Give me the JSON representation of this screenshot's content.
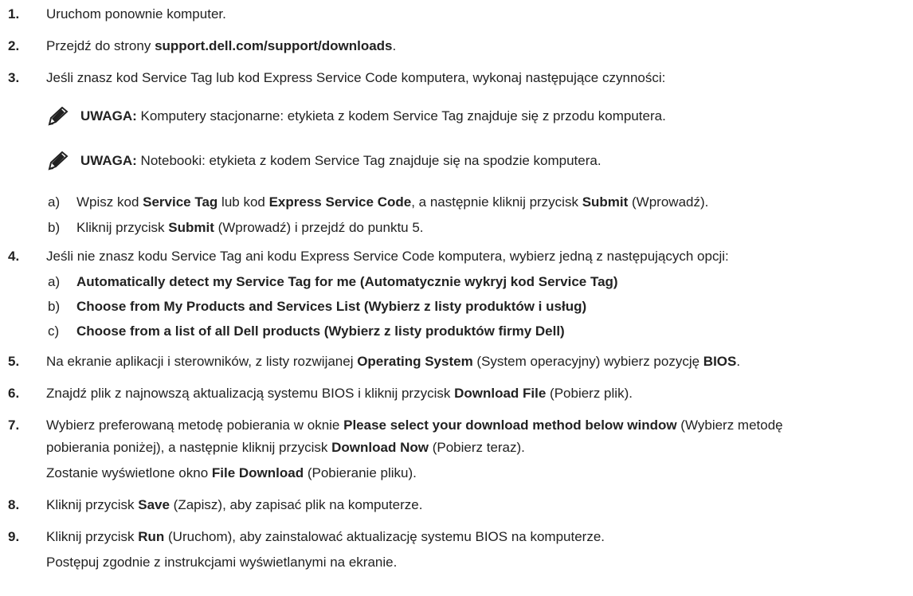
{
  "steps": [
    {
      "num": "1.",
      "segments": [
        {
          "t": "Uruchom ponownie komputer."
        }
      ]
    },
    {
      "num": "2.",
      "segments": [
        {
          "t": "Przejdź do strony "
        },
        {
          "t": "support.dell.com/support/downloads",
          "b": true
        },
        {
          "t": "."
        }
      ]
    },
    {
      "num": "3.",
      "segments": [
        {
          "t": "Jeśli znasz kod Service Tag lub kod Express Service Code komputera, wykonaj następujące czynności:"
        }
      ]
    },
    {
      "num": "4.",
      "segments": [
        {
          "t": "Jeśli nie znasz kodu Service Tag ani kodu Express Service Code komputera, wybierz jedną z następujących opcji:"
        }
      ]
    },
    {
      "num": "5.",
      "segments": [
        {
          "t": "Na ekranie aplikacji i sterowników, z listy rozwijanej "
        },
        {
          "t": "Operating System",
          "b": true
        },
        {
          "t": " (System operacyjny) wybierz pozycję "
        },
        {
          "t": "BIOS",
          "b": true
        },
        {
          "t": "."
        }
      ]
    },
    {
      "num": "6.",
      "segments": [
        {
          "t": "Znajdź plik z najnowszą aktualizacją systemu BIOS i kliknij przycisk "
        },
        {
          "t": "Download File",
          "b": true
        },
        {
          "t": " (Pobierz plik)."
        }
      ]
    },
    {
      "num": "7.",
      "segments": [
        {
          "t": "Wybierz preferowaną metodę pobierania w oknie "
        },
        {
          "t": "Please select your download method below window",
          "b": true
        },
        {
          "t": " (Wybierz metodę"
        }
      ]
    },
    {
      "num": "8.",
      "segments": [
        {
          "t": "Kliknij przycisk "
        },
        {
          "t": "Save",
          "b": true
        },
        {
          "t": " (Zapisz), aby zapisać plik na komputerze."
        }
      ]
    },
    {
      "num": "9.",
      "segments": [
        {
          "t": "Kliknij przycisk "
        },
        {
          "t": "Run",
          "b": true
        },
        {
          "t": " (Uruchom), aby zainstalować aktualizację systemu BIOS na komputerze."
        }
      ]
    }
  ],
  "continuations": [
    {
      "segments": [
        {
          "t": "pobierania poniżej), a następnie kliknij przycisk "
        },
        {
          "t": "Download Now",
          "b": true
        },
        {
          "t": " (Pobierz teraz)."
        }
      ]
    },
    {
      "segments": [
        {
          "t": "Zostanie wyświetlone okno "
        },
        {
          "t": "File Download",
          "b": true
        },
        {
          "t": " (Pobieranie pliku)."
        }
      ]
    },
    {
      "segments": [
        {
          "t": "Postępuj zgodnie z instrukcjami wyświetlanymi na ekranie."
        }
      ]
    }
  ],
  "notes": [
    {
      "label": "UWAGA:",
      "text": " Komputery stacjonarne: etykieta z kodem Service Tag znajduje się z przodu komputera."
    },
    {
      "label": "UWAGA:",
      "text": " Notebooki: etykieta z kodem Service Tag znajduje się na spodzie komputera."
    }
  ],
  "substeps": [
    {
      "letter": "a)",
      "segments": [
        {
          "t": "Wpisz kod "
        },
        {
          "t": "Service Tag",
          "b": true
        },
        {
          "t": " lub kod "
        },
        {
          "t": "Express Service Code",
          "b": true
        },
        {
          "t": ", a następnie kliknij przycisk "
        },
        {
          "t": "Submit",
          "b": true
        },
        {
          "t": " (Wprowadź)."
        }
      ]
    },
    {
      "letter": "b)",
      "segments": [
        {
          "t": "Kliknij przycisk "
        },
        {
          "t": "Submit",
          "b": true
        },
        {
          "t": " (Wprowadź) i przejdź do punktu 5."
        }
      ]
    },
    {
      "letter": "a)",
      "segments": [
        {
          "t": "Automatically detect my Service Tag for me (Automatycznie wykryj kod Service Tag)",
          "b": true
        }
      ]
    },
    {
      "letter": "b)",
      "segments": [
        {
          "t": "Choose from My Products and Services List (Wybierz z listy produktów i usług)",
          "b": true
        }
      ]
    },
    {
      "letter": "c)",
      "segments": [
        {
          "t": "Choose from a list of all Dell products (Wybierz z listy produktów firmy Dell)",
          "b": true
        }
      ]
    }
  ],
  "icons": {
    "note": "pencil-note-icon"
  }
}
